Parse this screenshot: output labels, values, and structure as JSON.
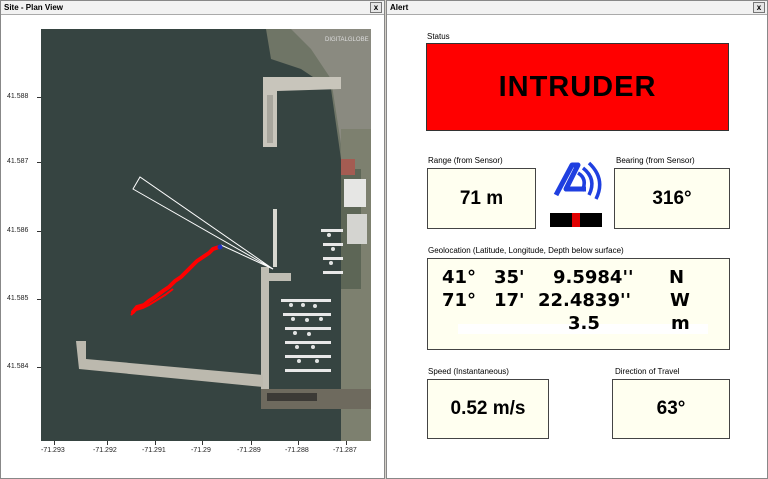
{
  "plan_window": {
    "title": "Site - Plan View",
    "close": "x",
    "watermark": "DIGITALGLOBE",
    "y_ticks": [
      "41.588",
      "41.587",
      "41.586",
      "41.585",
      "41.584"
    ],
    "x_ticks": [
      "-71.293",
      "-71.292",
      "-71.291",
      "-71.29",
      "-71.289",
      "-71.288",
      "-71.287"
    ]
  },
  "alert_window": {
    "title": "Alert",
    "close": "x",
    "status_label": "Status",
    "status_value": "INTRUDER",
    "range_label": "Range (from Sensor)",
    "range_value": "71 m",
    "bearing_label": "Bearing (from Sensor)",
    "bearing_value": "316°",
    "geo_label": "Geolocation (Latitude, Longitude, Depth below surface)",
    "lat": {
      "deg": "41°",
      "min": "35'",
      "sec": "9.5984''",
      "hemi": "N"
    },
    "lon": {
      "deg": "71°",
      "min": "17'",
      "sec": "22.4839''",
      "hemi": "W"
    },
    "depth": {
      "value": "3.5",
      "unit": "m"
    },
    "speed_label": "Speed (Instantaneous)",
    "speed_value": "0.52 m/s",
    "direction_label": "Direction of Travel",
    "direction_value": "63°"
  },
  "colors": {
    "status_bg": "#ff0000",
    "value_box_bg": "#fffff0",
    "track": "#ff0000",
    "logo": "#1f3fe0",
    "water": "#34423f"
  },
  "icons": [
    "sonar-logo-icon",
    "signal-level-icon",
    "close-icon"
  ]
}
